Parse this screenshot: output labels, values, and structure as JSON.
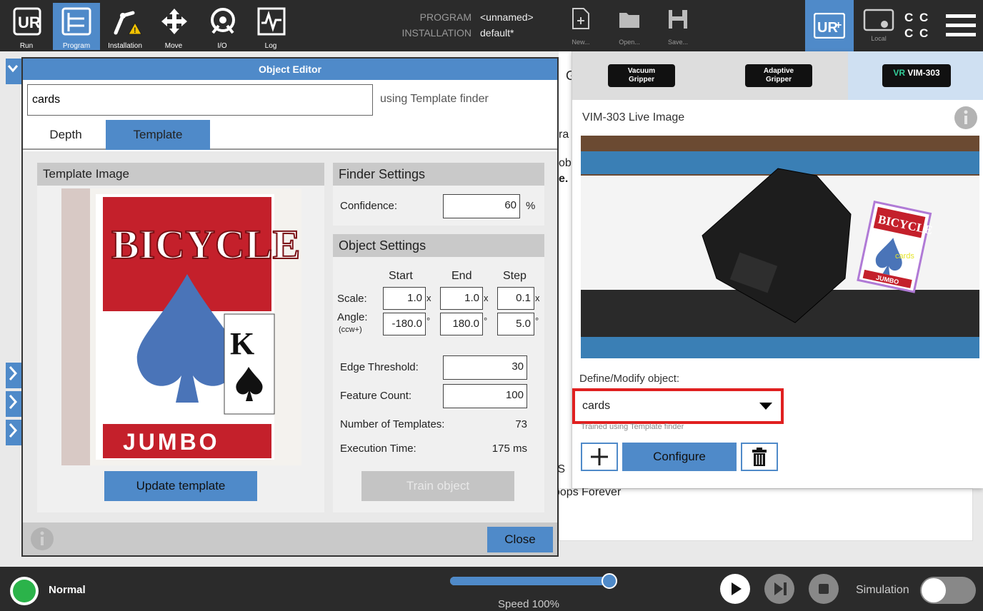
{
  "topbar": {
    "nav": [
      {
        "label": "Run"
      },
      {
        "label": "Program"
      },
      {
        "label": "Installation"
      },
      {
        "label": "Move"
      },
      {
        "label": "I/O"
      },
      {
        "label": "Log"
      }
    ],
    "program_label": "PROGRAM",
    "program_value": "<unnamed>",
    "installation_label": "INSTALLATION",
    "installation_value": "default*",
    "file_buttons": [
      {
        "label": "New..."
      },
      {
        "label": "Open..."
      },
      {
        "label": "Save..."
      }
    ],
    "local_label": "Local",
    "cc_text": "C C"
  },
  "background": {
    "frag_g": "G",
    "frag_ra": "ra",
    "frag_ob": "ob",
    "frag_e": "e.",
    "frag_s": "e S",
    "frag_loops": "oops Forever"
  },
  "editor": {
    "title": "Object Editor",
    "name_value": "cards",
    "finder_note": "using Template finder",
    "tabs": [
      {
        "label": "Depth"
      },
      {
        "label": "Template"
      }
    ],
    "template_image_title": "Template Image",
    "card_brand": "BICYCLE",
    "card_bottom": "JUMBO",
    "update_template": "Update template",
    "finder_settings_title": "Finder Settings",
    "confidence_label": "Confidence:",
    "confidence_value": "60",
    "confidence_unit": "%",
    "object_settings_title": "Object Settings",
    "col_start": "Start",
    "col_end": "End",
    "col_step": "Step",
    "scale_label": "Scale:",
    "scale_start": "1.0",
    "scale_end": "1.0",
    "scale_step": "0.1",
    "scale_unit": "x",
    "angle_label": "Angle:",
    "angle_sub": "(ccw+)",
    "angle_start": "-180.0",
    "angle_end": "180.0",
    "angle_step": "5.0",
    "angle_unit": "°",
    "edge_threshold_label": "Edge Threshold:",
    "edge_threshold_value": "30",
    "feature_count_label": "Feature Count:",
    "feature_count_value": "100",
    "num_templates_label": "Number of Templates:",
    "num_templates_value": "73",
    "exec_time_label": "Execution Time:",
    "exec_time_value": "175 ms",
    "train_object": "Train object",
    "close": "Close"
  },
  "right": {
    "tabs": [
      {
        "label_line1": "Vacuum",
        "label_line2": "Gripper"
      },
      {
        "label_line1": "Adaptive",
        "label_line2": "Gripper"
      },
      {
        "label": "VIM-303"
      }
    ],
    "live_image_title": "VIM-303 Live Image",
    "detected_label": "cards",
    "card_text": "BICYCLE",
    "card_bottom": "JUMBO",
    "define_label": "Define/Modify object:",
    "selected_object": "cards",
    "trained_note": "Trained using Template finder",
    "configure": "Configure"
  },
  "bottombar": {
    "status": "Normal",
    "speed_label": "Speed 100%",
    "speed_value": 1.0,
    "simulation_label": "Simulation"
  },
  "colors": {
    "accent": "#4f8ac9",
    "highlight": "#e02020",
    "status_ok": "#2bb34a"
  }
}
